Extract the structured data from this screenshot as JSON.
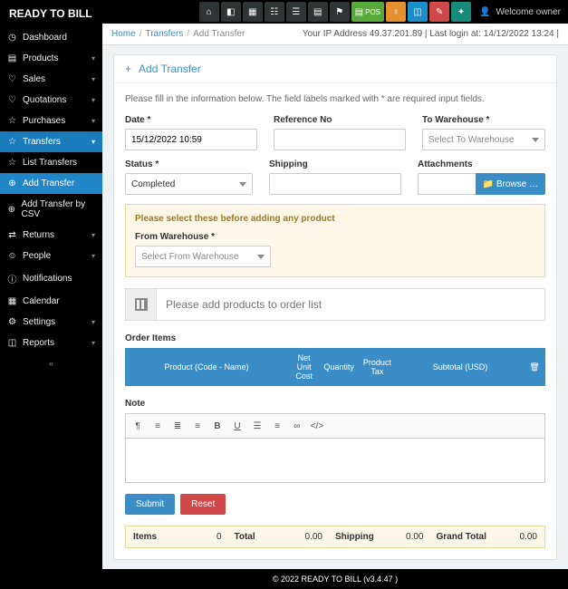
{
  "brand": "READY TO BILL",
  "sidebar": {
    "items": [
      {
        "icon": "📊",
        "label": "Dashboard",
        "chev": ""
      },
      {
        "icon": "▾",
        "label": "Products",
        "chev": "▾"
      },
      {
        "icon": "♡",
        "label": "Sales",
        "chev": "▾"
      },
      {
        "icon": "♡",
        "label": "Quotations",
        "chev": "▾"
      },
      {
        "icon": "☆",
        "label": "Purchases",
        "chev": "▾"
      },
      {
        "icon": "☆",
        "label": "Transfers",
        "chev": "▾",
        "active": true
      },
      {
        "icon": "☆",
        "label": "List Transfers",
        "chev": ""
      },
      {
        "icon": "⊕",
        "label": "Add Transfer",
        "chev": "",
        "subactive": true
      },
      {
        "icon": "⊕",
        "label": "Add Transfer by CSV",
        "chev": ""
      },
      {
        "icon": "⇄",
        "label": "Returns",
        "chev": "▾"
      },
      {
        "icon": "👥",
        "label": "People",
        "chev": "▾"
      },
      {
        "icon": "ⓘ",
        "label": "Notifications",
        "chev": ""
      },
      {
        "icon": "📅",
        "label": "Calendar",
        "chev": ""
      },
      {
        "icon": "⚙",
        "label": "Settings",
        "chev": "▾"
      },
      {
        "icon": "📈",
        "label": "Reports",
        "chev": "▾"
      }
    ],
    "collapse": "«"
  },
  "topbar": {
    "welcome": "Welcome owner",
    "pos_label": "POS"
  },
  "breadcrumb": {
    "home": "Home",
    "section": "Transfers",
    "current": "Add Transfer",
    "ip": "Your IP Address 49.37.201.89 | Last login at: 14/12/2022 13:24 |"
  },
  "panel": {
    "title": "Add Transfer",
    "intro": "Please fill in the information below. The field labels marked with * are required input fields.",
    "labels": {
      "date": "Date *",
      "ref": "Reference No",
      "to_wh": "To Warehouse *",
      "status": "Status *",
      "shipping": "Shipping",
      "attach": "Attachments",
      "from_wh": "From Warehouse *",
      "note": "Note",
      "order_items": "Order Items"
    },
    "values": {
      "date": "15/12/2022 10:59",
      "to_wh": "Select To Warehouse",
      "status": "Completed",
      "from_wh": "Select From Warehouse"
    },
    "browse": "Browse …",
    "warn": "Please select these before adding any product",
    "product_ph": "Please add products to order list",
    "table_headers": {
      "product": "Product (Code - Name)",
      "cost": "Net Unit Cost",
      "qty": "Quantity",
      "tax": "Product Tax",
      "subtotal": "Subtotal (USD)"
    },
    "buttons": {
      "submit": "Submit",
      "reset": "Reset"
    },
    "totals": {
      "items_lbl": "Items",
      "items_val": "0",
      "total_lbl": "Total",
      "total_val": "0.00",
      "ship_lbl": "Shipping",
      "ship_val": "0.00",
      "grand_lbl": "Grand Total",
      "grand_val": "0.00"
    }
  },
  "footer": {
    "text": "© 2022 READY TO BILL (v3.4.47 )"
  }
}
